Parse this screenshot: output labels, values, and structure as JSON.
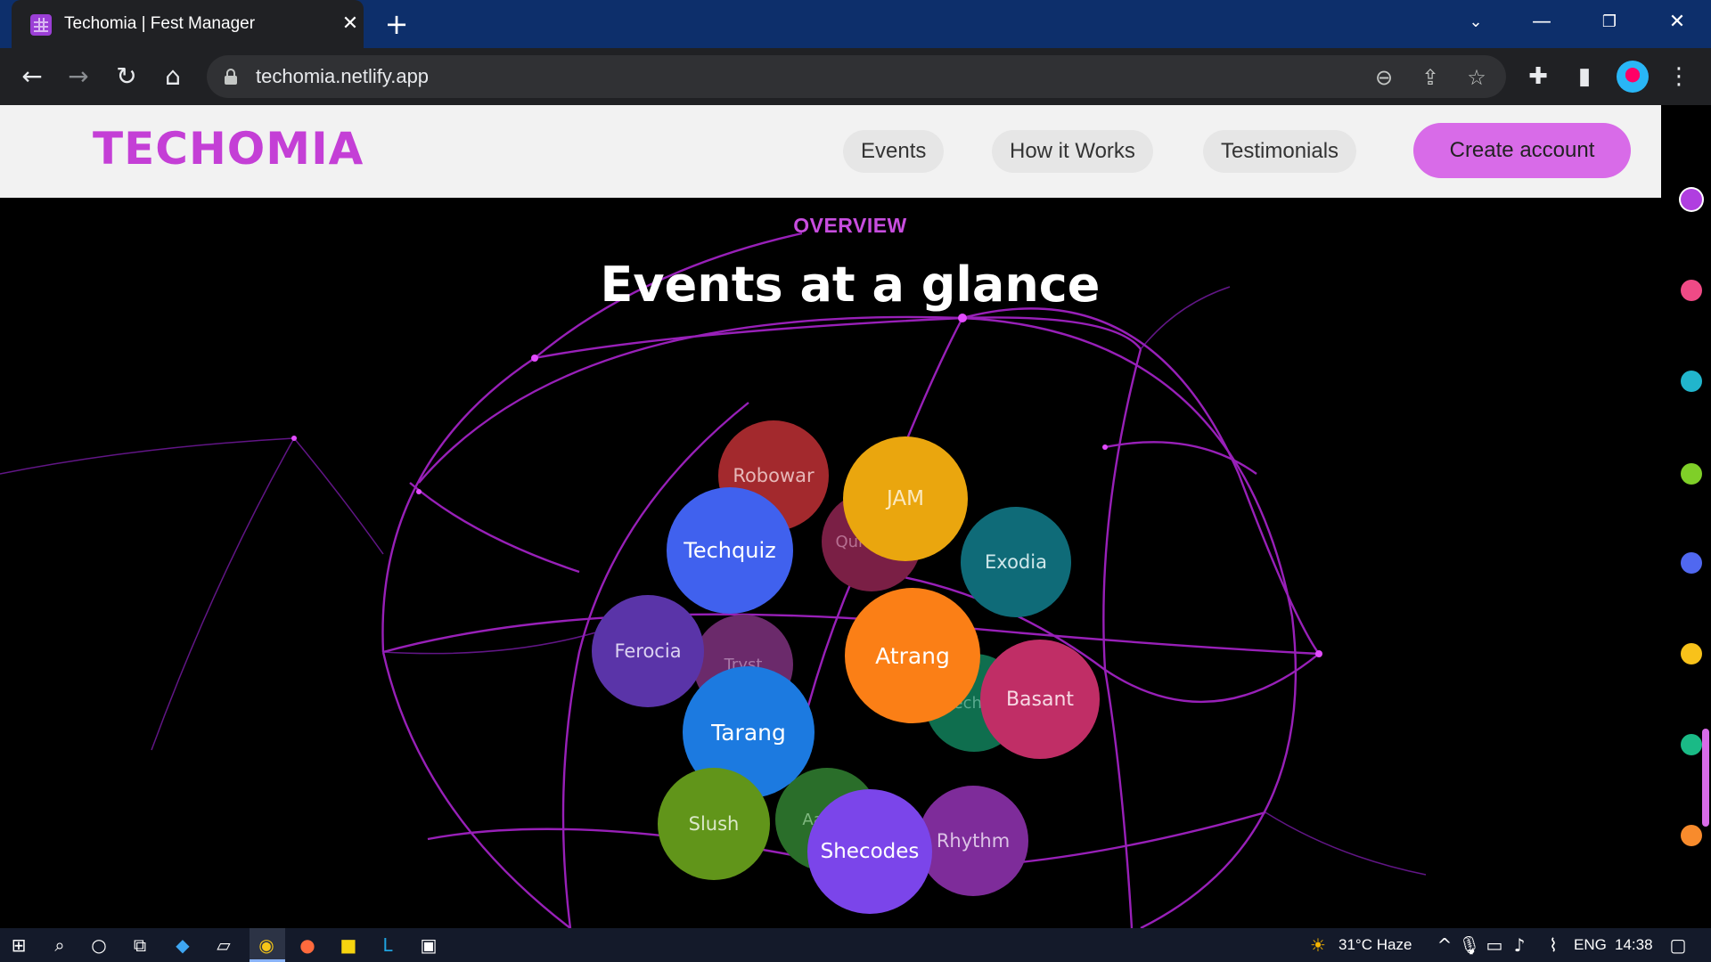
{
  "browser": {
    "tab_title": "Techomia | Fest Manager",
    "url": "techomia.netlify.app",
    "icons": [
      "back-icon",
      "forward-icon",
      "reload-icon",
      "home-icon",
      "lock-icon",
      "zoom-out-icon",
      "share-icon",
      "star-icon",
      "extensions-icon",
      "side-panel-icon",
      "profile-avatar",
      "menu-icon"
    ]
  },
  "site": {
    "logo": "TECHOMIA",
    "nav": [
      "Events",
      "How it Works",
      "Testimonials"
    ],
    "cta": "Create account",
    "accent": "#c43fd6"
  },
  "section": {
    "eyebrow": "OVERVIEW",
    "title": "Events at a glance"
  },
  "events": [
    {
      "name": "Robowar",
      "color": "#a3292d"
    },
    {
      "name": "Quriosity",
      "color": "#7a1f45"
    },
    {
      "name": "JAM",
      "color": "#eaa60e"
    },
    {
      "name": "Techquiz",
      "color": "#4061ee"
    },
    {
      "name": "Exodia",
      "color": "#0f6b78"
    },
    {
      "name": "Ferocia",
      "color": "#5a34a8"
    },
    {
      "name": "Tryst",
      "color": "#6b2a6b"
    },
    {
      "name": "Techno",
      "color": "#0f6e4e"
    },
    {
      "name": "Atrang",
      "color": "#fb7f16"
    },
    {
      "name": "Basant",
      "color": "#c02e66"
    },
    {
      "name": "Tarang",
      "color": "#1c7ae0"
    },
    {
      "name": "Aagaz",
      "color": "#2a6e2a"
    },
    {
      "name": "Slush",
      "color": "#61951a"
    },
    {
      "name": "Rhythm",
      "color": "#7e2c9a"
    },
    {
      "name": "Shecodes",
      "color": "#7b45ea"
    }
  ],
  "side_dots": [
    "#b03ee0",
    "#ef4a86",
    "#21b5cc",
    "#7fcf28",
    "#5068f0",
    "#f8c21a",
    "#1aba86",
    "#f88b2c"
  ],
  "taskbar": {
    "weather": "31°C  Haze",
    "lang": "ENG",
    "time": "14:38"
  }
}
